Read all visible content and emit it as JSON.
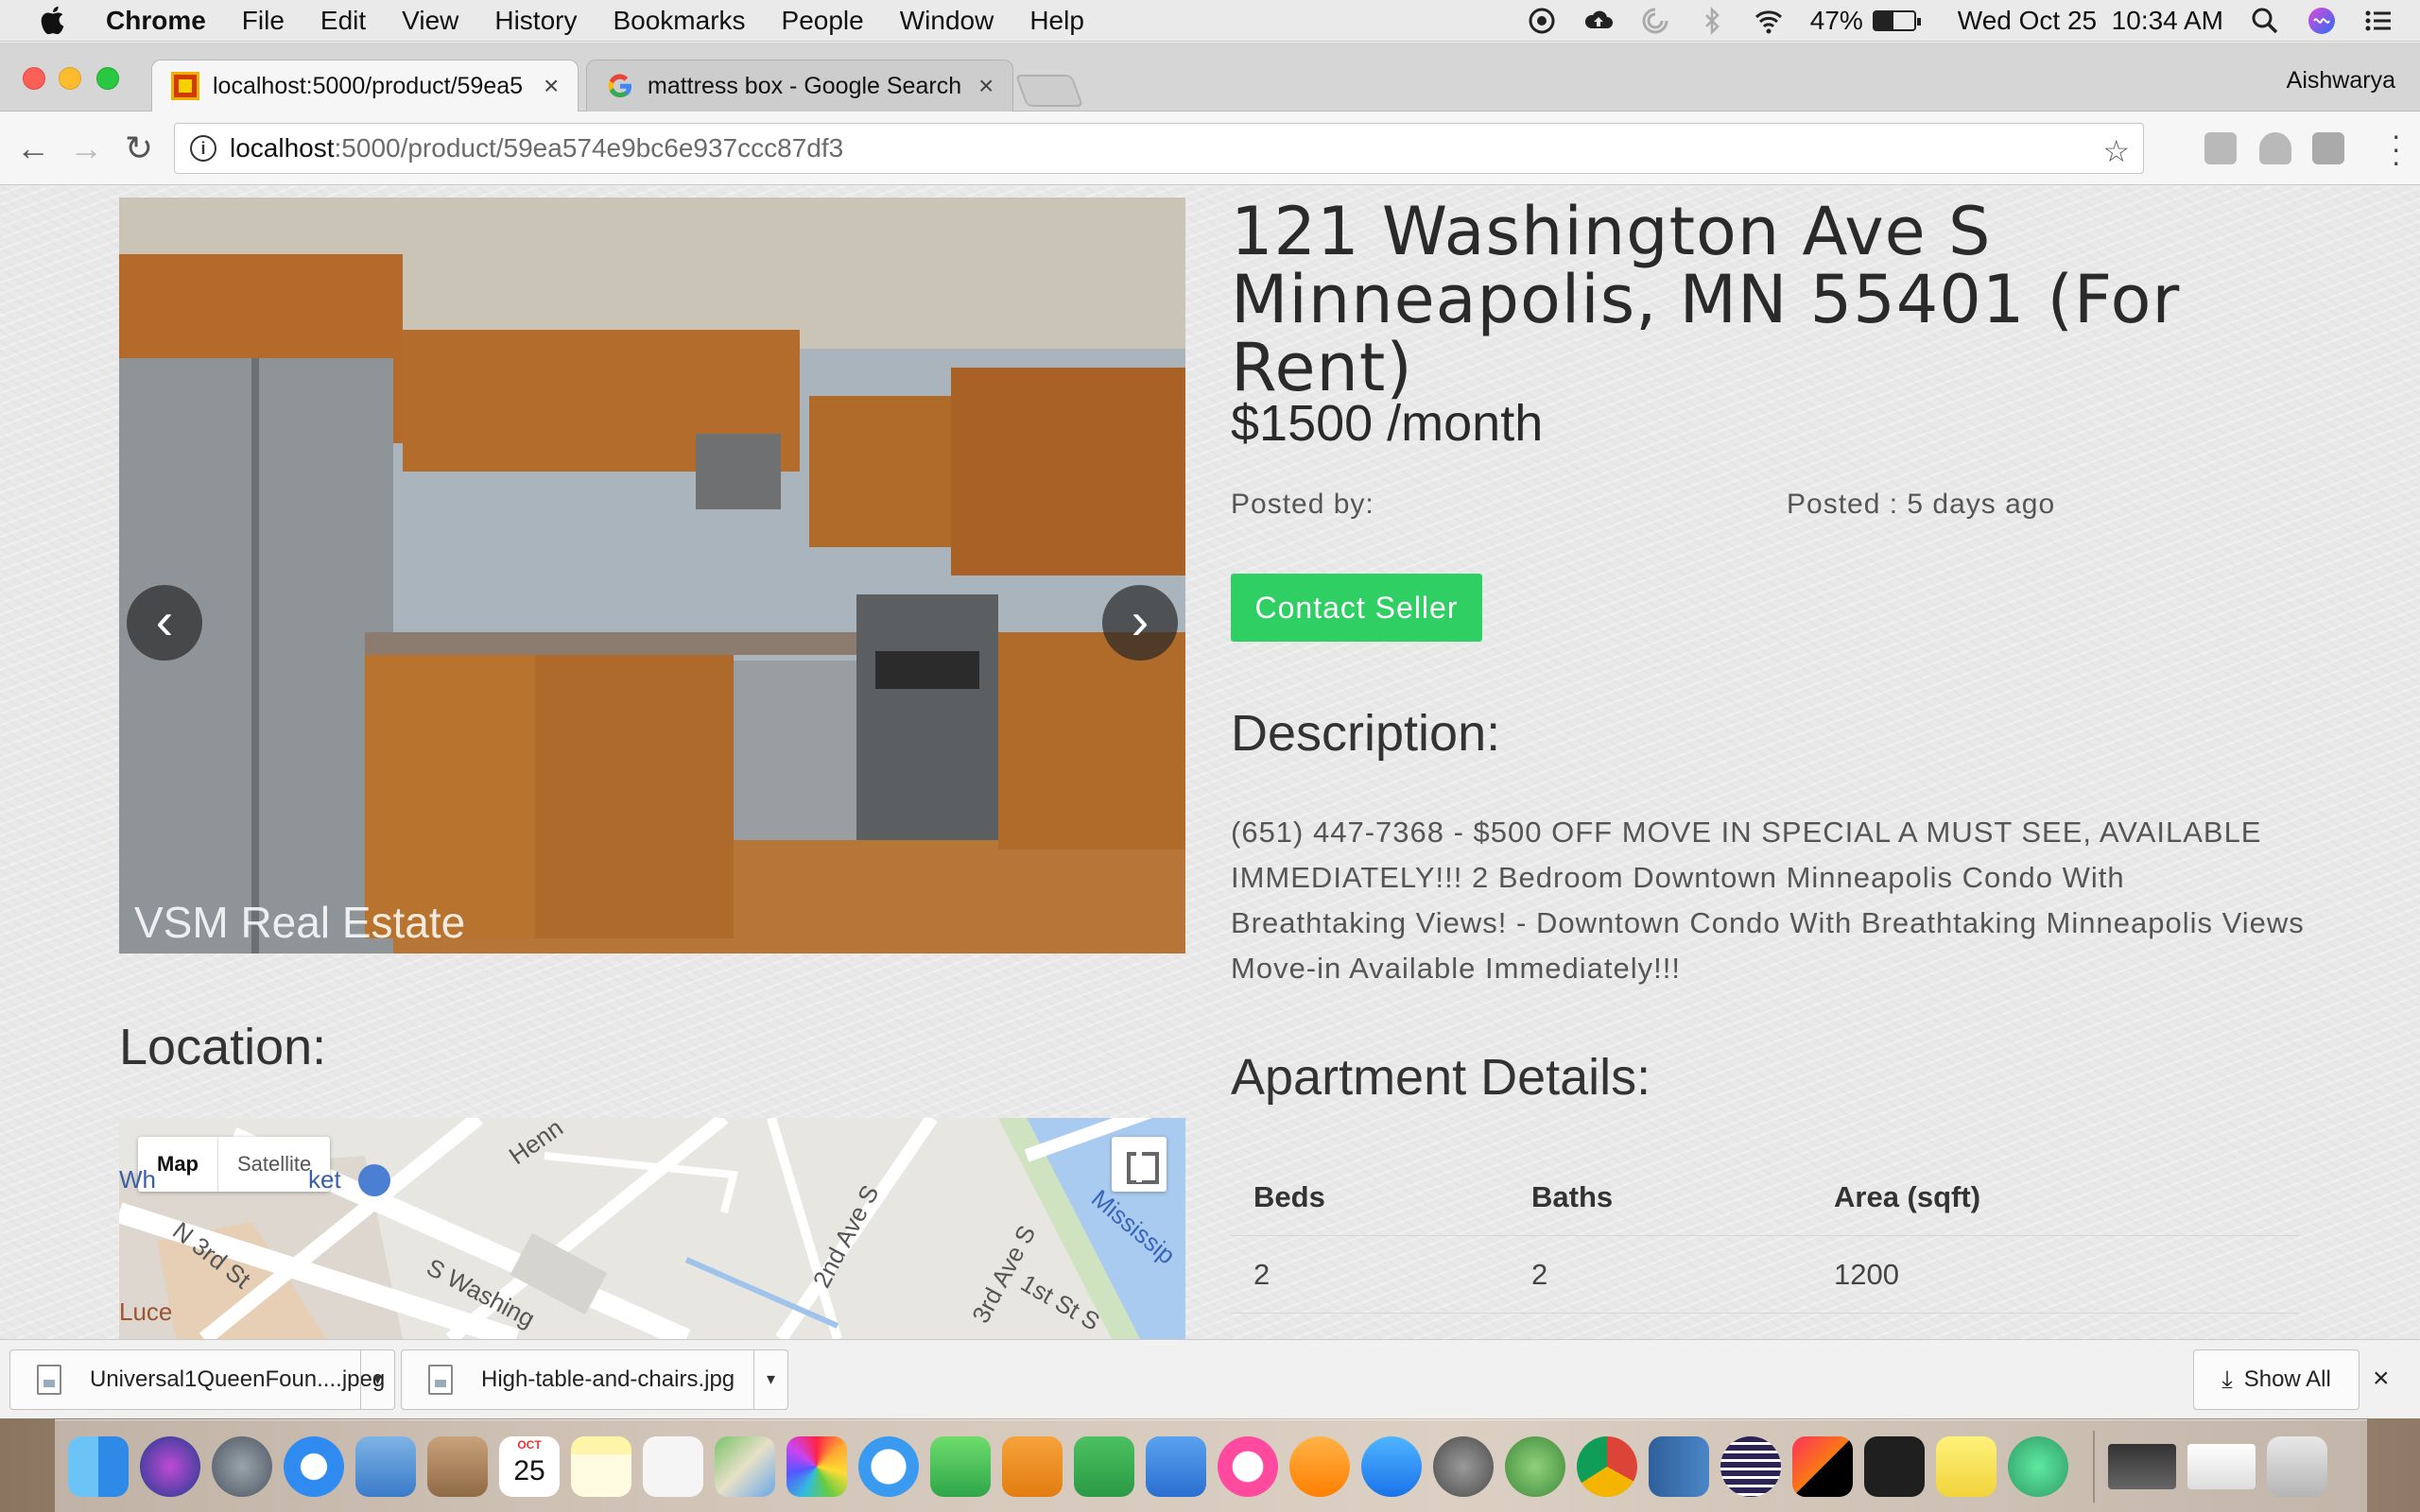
{
  "menubar": {
    "app_name": "Chrome",
    "items": [
      "File",
      "Edit",
      "View",
      "History",
      "Bookmarks",
      "People",
      "Window",
      "Help"
    ],
    "battery_percent": "47%",
    "battery_level": 0.47,
    "datetime": "Wed Oct 25  10:34 AM",
    "status_icons": [
      "eye-icon",
      "cloud-upload-icon",
      "sync-icon",
      "bluetooth-icon",
      "wifi-icon",
      "battery-icon",
      "spotlight-search-icon",
      "siri-icon",
      "notification-center-icon"
    ]
  },
  "browser": {
    "tabs": [
      {
        "title": "localhost:5000/product/59ea5",
        "active": true,
        "favicon": "site-favicon-icon"
      },
      {
        "title": "mattress box - Google Search",
        "active": false,
        "favicon": "google-icon"
      }
    ],
    "close_glyph": "×",
    "profile_name": "Aishwarya",
    "url_host": "localhost",
    "url_path": ":5000/product/59ea574e9bc6e937ccc87df3",
    "nav": {
      "back": "←",
      "forward": "→",
      "reload": "↻"
    },
    "star_glyph": "☆"
  },
  "listing": {
    "carousel_watermark": "VSM Real Estate",
    "carousel_prev": "‹",
    "carousel_next": "›",
    "title": "121 Washington Ave S Minneapolis, MN 55401 (For Rent)",
    "price": "$1500 /month",
    "posted_by_label": "Posted by:",
    "posted_ago": "Posted : 5 days ago",
    "contact_button": "Contact Seller",
    "description_title": "Description:",
    "description": "(651) 447-7368 - $500 OFF MOVE IN SPECIAL A MUST SEE, AVAILABLE IMMEDIATELY!!! 2 Bedroom Downtown Minneapolis Condo With Breathtaking Views! - Downtown Condo With Breathtaking Minneapolis Views Move-in Available Immediately!!!",
    "location_title": "Location:",
    "apartment_details_title": "Apartment Details:",
    "details": {
      "headers": [
        "Beds",
        "Baths",
        "Area (sqft)"
      ],
      "rows": [
        [
          "2",
          "2",
          "1200"
        ]
      ]
    }
  },
  "map": {
    "type_options": [
      "Map",
      "Satellite"
    ],
    "selected_type": "Map",
    "labels": [
      "Henn",
      "ket",
      "N 3rd St",
      "S Washing",
      "2nd Ave S",
      "3rd Ave S",
      "1st St S",
      "Mississip",
      "Luce",
      "Wh"
    ]
  },
  "downloads": {
    "items": [
      "Universal1QueenFoun....jpeg",
      "High-table-and-chairs.jpg"
    ],
    "show_all": "Show All",
    "close_glyph": "×"
  },
  "dock": {
    "apps": [
      "finder-icon",
      "siri-icon",
      "launchpad-icon",
      "safari-icon",
      "mail-icon",
      "contacts-icon",
      "calendar-icon",
      "notes-icon",
      "reminders-icon",
      "maps-icon",
      "photos-icon",
      "messages-icon",
      "facetime-icon",
      "pages-icon",
      "numbers-icon",
      "keynote-icon",
      "itunes-icon",
      "ibooks-icon",
      "app-store-icon",
      "system-preferences-icon",
      "android-studio-icon",
      "chrome-icon",
      "notebook-icon",
      "eclipse-icon",
      "intellij-icon",
      "terminal-icon",
      "stickies-icon",
      "atom-icon"
    ],
    "calendar_month": "OCT",
    "calendar_day": "25"
  },
  "colors": {
    "accent_green": "#2fcf63",
    "page_bg": "#e9e9e9"
  }
}
